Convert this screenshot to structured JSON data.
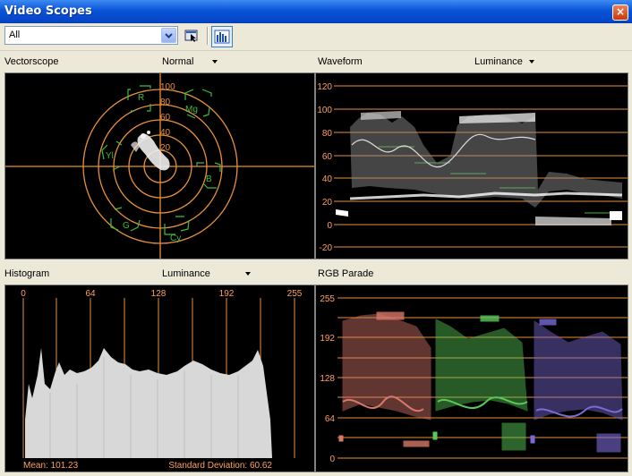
{
  "window": {
    "title": "Video Scopes",
    "close_label": "×"
  },
  "toolbar": {
    "source_selected": "All",
    "icons": [
      "dropdown-arrow-icon",
      "pick-tool-icon",
      "scope-layout-icon"
    ]
  },
  "vectorscope": {
    "title": "Vectorscope",
    "mode": "Normal",
    "ring_labels": [
      "100",
      "80",
      "60",
      "40",
      "20"
    ],
    "targets": [
      "R",
      "Mg",
      "B",
      "Cy",
      "G",
      "Yl"
    ],
    "colors": {
      "graticule": "#e8903a",
      "target": "#3cbc3c"
    }
  },
  "waveform": {
    "title": "Waveform",
    "mode": "Luminance",
    "y_labels": [
      "120",
      "100",
      "80",
      "60",
      "40",
      "20",
      "0",
      "-20"
    ],
    "colors": {
      "graticule": "#e8903a",
      "label": "#ffa060"
    }
  },
  "histogram": {
    "title": "Histogram",
    "mode": "Luminance",
    "x_labels": [
      "0",
      "64",
      "128",
      "192",
      "255"
    ],
    "mean_text": "Mean: 101.23",
    "stddev_text": "Standard Deviation: 60.62",
    "colors": {
      "graticule": "#e8903a",
      "label": "#ffa060"
    }
  },
  "rgb_parade": {
    "title": "RGB Parade",
    "y_labels": [
      "255",
      "192",
      "128",
      "64",
      "0"
    ],
    "colors": {
      "red": "#e08070",
      "green": "#60d060",
      "blue": "#8070e0",
      "graticule": "#e8903a"
    }
  }
}
